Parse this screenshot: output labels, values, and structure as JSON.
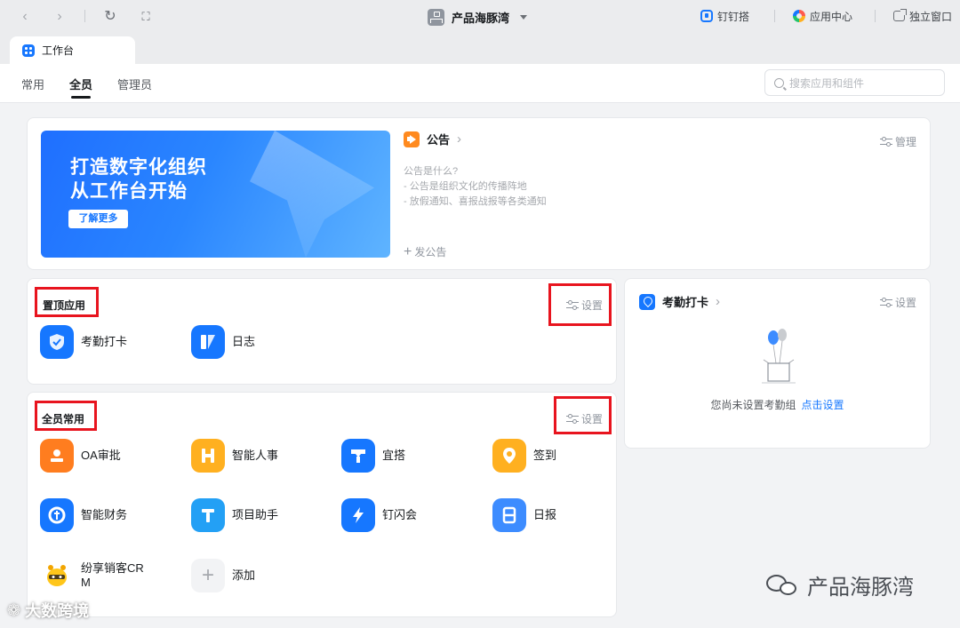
{
  "topbar": {
    "org_name": "产品海豚湾",
    "dingtalk_link": "钉钉搭",
    "app_center_link": "应用中心",
    "standalone_window": "独立窗口"
  },
  "window_tab": {
    "label": "工作台"
  },
  "subtabs": [
    "常用",
    "全员",
    "管理员"
  ],
  "active_subtab": "全员",
  "search": {
    "placeholder": "搜索应用和组件"
  },
  "banner": {
    "line1": "打造数字化组织",
    "line2": "从工作台开始",
    "button": "了解更多"
  },
  "announcement": {
    "title": "公告",
    "manage": "管理",
    "lines": [
      "公告是什么?",
      "- 公告是组织文化的传播阵地",
      "- 放假通知、喜报战报等各类通知"
    ],
    "post": "发公告"
  },
  "pinned_apps": {
    "title": "置顶应用",
    "setting": "设置",
    "apps": [
      {
        "label": "考勤打卡",
        "icon": "attendance-shield-icon",
        "color": "#1677ff"
      },
      {
        "label": "日志",
        "icon": "log-icon",
        "color": "#1677ff"
      }
    ]
  },
  "common_apps": {
    "title": "全员常用",
    "setting": "设置",
    "apps": [
      {
        "label": "OA审批",
        "icon": "oa-approval-icon",
        "color": "#ff7d1f"
      },
      {
        "label": "智能人事",
        "icon": "smart-hr-icon",
        "color": "#ffb020"
      },
      {
        "label": "宜搭",
        "icon": "yida-icon",
        "color": "#1677ff"
      },
      {
        "label": "签到",
        "icon": "checkin-icon",
        "color": "#ffb020"
      },
      {
        "label": "智能财务",
        "icon": "smart-finance-icon",
        "color": "#1677ff"
      },
      {
        "label": "项目助手",
        "icon": "project-assistant-icon",
        "color": "#23a0f5"
      },
      {
        "label": "钉闪会",
        "icon": "flash-meeting-icon",
        "color": "#1677ff"
      },
      {
        "label": "日报",
        "icon": "daily-report-icon",
        "color": "#3d8cff"
      },
      {
        "label": "纷享销客CR\nM",
        "icon": "fxiaoke-crm-icon",
        "color": "#ffc61a"
      },
      {
        "label": "添加",
        "icon": "add-icon",
        "color": "#f2f3f5"
      }
    ]
  },
  "attendance": {
    "title": "考勤打卡",
    "setting": "设置",
    "empty_text": "您尚未设置考勤组",
    "empty_link": "点击设置"
  },
  "watermarks": {
    "right": "产品海豚湾",
    "left": "大数跨境"
  },
  "colors": {
    "accent": "#1677ff",
    "highlight_box": "#e8141e"
  }
}
